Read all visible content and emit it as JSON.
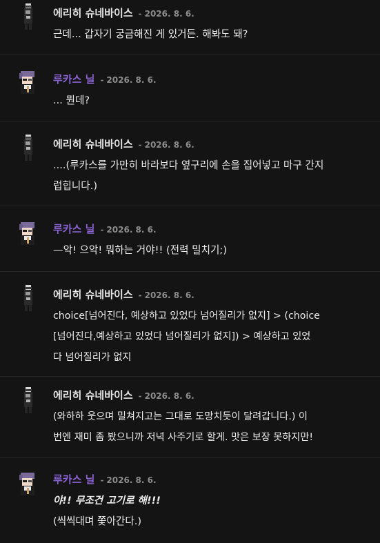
{
  "colors": {
    "background": "#141414",
    "divider": "#262626",
    "erich_name": "#e6e6e6",
    "lucas_name": "#8a63d2",
    "timestamp": "#8c8c8c",
    "text": "#ececec"
  },
  "messages": [
    {
      "author": "에리히 슈네바이스",
      "separator": "-",
      "date": "2026. 8. 6.",
      "avatar": "erich-avatar-icon",
      "lines": [
        {
          "text": "근데... 갑자기 궁금해진 게 있거든. 해봐도 돼?"
        }
      ]
    },
    {
      "author": "루카스 닐",
      "separator": "-",
      "date": "2026. 8. 6.",
      "avatar": "lucas-avatar-icon",
      "lines": [
        {
          "text": "... 뭔데?"
        }
      ]
    },
    {
      "author": "에리히 슈네바이스",
      "separator": "-",
      "date": "2026. 8. 6.",
      "avatar": "erich-avatar-icon",
      "lines": [
        {
          "text": "....(루카스를 가만히 바라보다 옆구리에 손을 집어넣고 마구 간지"
        },
        {
          "text": "럽힙니다.)"
        }
      ]
    },
    {
      "author": "루카스 닐",
      "separator": "-",
      "date": "2026. 8. 6.",
      "avatar": "lucas-avatar-icon",
      "lines": [
        {
          "text": "—악! 으악! 뭐하는 거야!! (전력 밀치기;)"
        }
      ]
    },
    {
      "author": "에리히 슈네바이스",
      "separator": "-",
      "date": "2026. 8. 6.",
      "avatar": "erich-avatar-icon",
      "lines": [
        {
          "text": "choice[넘어진다, 예상하고 있었다 넘어질리가 없지] > (choice"
        },
        {
          "text": "[넘어진다,예상하고 있었다 넘어질리가 없지]) > 예상하고 있었"
        },
        {
          "text": "다 넘어질리가 없지"
        }
      ]
    },
    {
      "author": "에리히 슈네바이스",
      "separator": "-",
      "date": "2026. 8. 6.",
      "avatar": "erich-avatar-icon",
      "lines": [
        {
          "text": "(와하하 웃으며 밀쳐지고는 그대로 도망치듯이 달려갑니다.) 이"
        },
        {
          "text": "번엔 재미 좀 봤으니까 저녁 사주기로 할게. 맛은 보장 못하지만!"
        }
      ]
    },
    {
      "author": "루카스 닐",
      "separator": "-",
      "date": "2026. 8. 6.",
      "avatar": "lucas-avatar-icon",
      "lines": [
        {
          "text": "야!! 무조건 고기로 해!!!",
          "style": "bold-italic"
        },
        {
          "text": "(씩씩대며 쫓아간다.)"
        }
      ]
    }
  ]
}
